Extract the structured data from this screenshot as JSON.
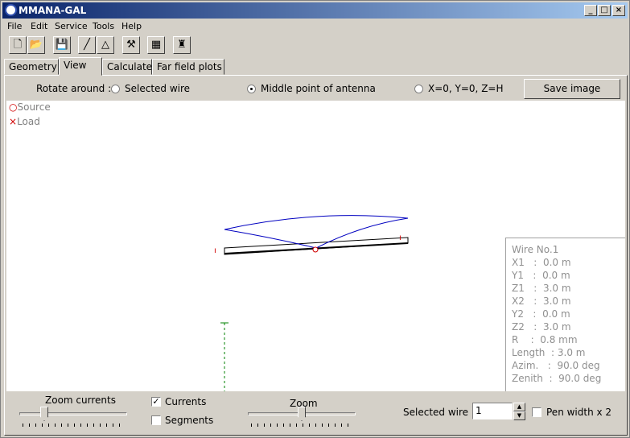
{
  "window": {
    "title": "MMANA-GAL"
  },
  "menu": [
    "File",
    "Edit",
    "Service",
    "Tools",
    "Help"
  ],
  "tabs": [
    "Geometry",
    "View",
    "Calculate",
    "Far field plots"
  ],
  "rotate": {
    "label": "Rotate around :",
    "options": [
      "Selected wire",
      "Middle point of antenna",
      "X=0, Y=0, Z=H"
    ],
    "selected": "Middle point of antenna",
    "save_label": "Save image"
  },
  "legend": {
    "source": "Source",
    "load": "Load"
  },
  "wire_info": [
    "Wire No.1",
    "X1   :  0.0 m",
    "Y1   :  0.0 m",
    "Z1   :  3.0 m",
    "X2   :  3.0 m",
    "Y2   :  0.0 m",
    "Z2   :  3.0 m",
    "R    :  0.8 mm",
    "Length  : 3.0 m",
    "Azim.   :  90.0 deg",
    "Zenith  :  90.0 deg"
  ],
  "controls": {
    "zoom_currents_label": "Zoom currents",
    "zoom_currents_level": 0.2,
    "currents_label": "Currents",
    "currents_checked": true,
    "segments_label": "Segments",
    "segments_checked": false,
    "zoom_label": "Zoom",
    "zoom_level": 0.5,
    "selected_wire_label": "Selected wire",
    "selected_wire_value": "1",
    "pen_width_label": "Pen width x 2",
    "pen_width_checked": false
  },
  "colors": {
    "title_start": "#0a246a",
    "current": "#0000c0",
    "source": "#d00000",
    "axis": "#008000"
  }
}
